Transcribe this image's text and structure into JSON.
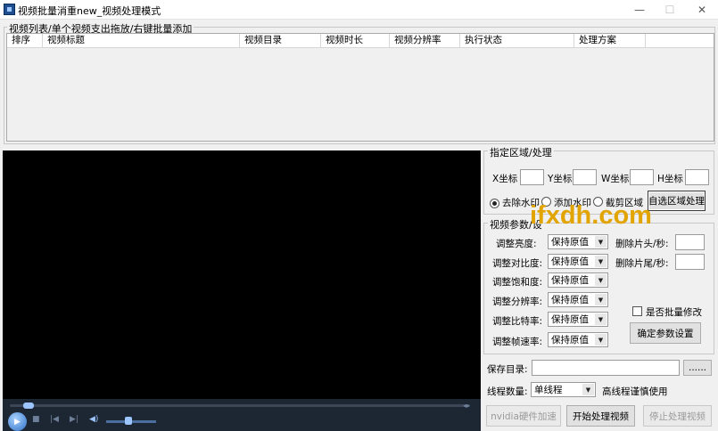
{
  "window": {
    "title": "视频批量消重new_视频处理模式"
  },
  "list_group": {
    "label": "视频列表/单个视频支出拖放/右键批量添加",
    "columns": [
      "排序",
      "视频标题",
      "视频目录",
      "视频时长",
      "视频分辨率",
      "执行状态",
      "处理方案"
    ]
  },
  "region": {
    "label": "指定区域/处理",
    "x_label": "X坐标",
    "y_label": "Y坐标",
    "w_label": "W坐标",
    "h_label": "H坐标",
    "x_value": "",
    "y_value": "",
    "w_value": "",
    "h_value": "",
    "radio_remove": "去除水印",
    "radio_add": "添加水印",
    "radio_crop": "截剪区域",
    "selected": "去除水印",
    "process_button": "自选区域处理"
  },
  "params": {
    "label": "视频参数/设",
    "brightness_label": "调整亮度:",
    "contrast_label": "调整对比度:",
    "saturation_label": "调整饱和度:",
    "resolution_label": "调整分辨率:",
    "bitrate_label": "调整比特率:",
    "framerate_label": "调整帧速率:",
    "keep_value": "保持原值",
    "trim_head_label": "删除片头/秒:",
    "trim_tail_label": "删除片尾/秒:",
    "trim_head_value": "",
    "trim_tail_value": "",
    "batch_label": "是否批量修改",
    "batch_checked": false,
    "confirm_button": "确定参数设置"
  },
  "save": {
    "dir_label": "保存目录:",
    "dir_value": "",
    "browse_button": "......",
    "threads_label": "线程数量:",
    "threads_value": "单线程",
    "threads_note": "高线程谨慎使用"
  },
  "actions": {
    "nvidia_button": "nvidia硬件加速",
    "start_button": "开始处理视频",
    "stop_button": "停止处理视频"
  },
  "watermark_text": "ifxdh.com",
  "player": {
    "seek_fraction": 0.03,
    "volume_fraction": 0.45
  }
}
